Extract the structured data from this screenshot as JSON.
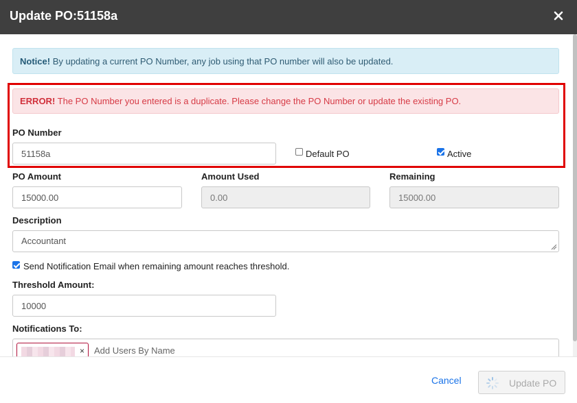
{
  "modal": {
    "title": "Update PO:51158a",
    "close_icon": "close-icon"
  },
  "notice": {
    "strong": "Notice!",
    "text": "By updating a current PO Number, any job using that PO number will also be updated."
  },
  "error": {
    "strong": "ERROR!",
    "text": "The PO Number you entered is a duplicate. Please change the PO Number or update the existing PO."
  },
  "po_number": {
    "label": "PO Number",
    "value": "51158a"
  },
  "default_po": {
    "label": "Default PO",
    "checked": false
  },
  "active": {
    "label": "Active",
    "checked": true
  },
  "po_amount": {
    "label": "PO Amount",
    "value": "15000.00"
  },
  "amount_used": {
    "label": "Amount Used",
    "value": "0.00"
  },
  "remaining": {
    "label": "Remaining",
    "value": "15000.00"
  },
  "description": {
    "label": "Description",
    "value": "Accountant"
  },
  "send_notification": {
    "label": "Send Notification Email when remaining amount reaches threshold.",
    "checked": true
  },
  "threshold": {
    "label": "Threshold Amount:",
    "value": "10000"
  },
  "notifications": {
    "label": "Notifications To:",
    "remove": "×",
    "placeholder": "Add Users By Name"
  },
  "footer": {
    "cancel": "Cancel",
    "update": "Update PO"
  },
  "colors": {
    "header_bg": "#3f3f3f",
    "highlight_border": "#e00000",
    "link": "#1a73e8"
  }
}
